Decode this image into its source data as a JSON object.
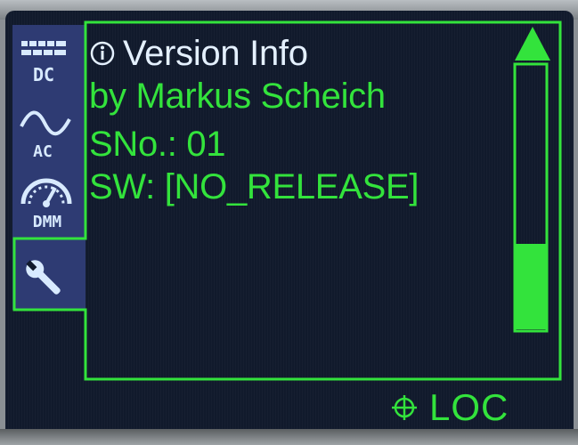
{
  "screen": {
    "title": "Version Info",
    "author": "by Markus Scheich",
    "serial": "SNo.: 01",
    "software": "SW: [NO_RELEASE]"
  },
  "tabs": [
    {
      "label": "DC",
      "icon": "dc-icon",
      "active": false
    },
    {
      "label": "AC",
      "icon": "ac-wave-icon",
      "active": false
    },
    {
      "label": "DMM",
      "icon": "meter-gauge-icon",
      "active": false
    },
    {
      "label": "",
      "icon": "wrench-icon",
      "active": true
    }
  ],
  "status_bar": {
    "lock_label": "LOC"
  },
  "scrollbar": {
    "position": "bottom"
  },
  "colors": {
    "accent_green": "#33e33c",
    "tab_blue": "#2e3b73",
    "background": "#111a2c",
    "icon_light": "#d8eaff"
  }
}
